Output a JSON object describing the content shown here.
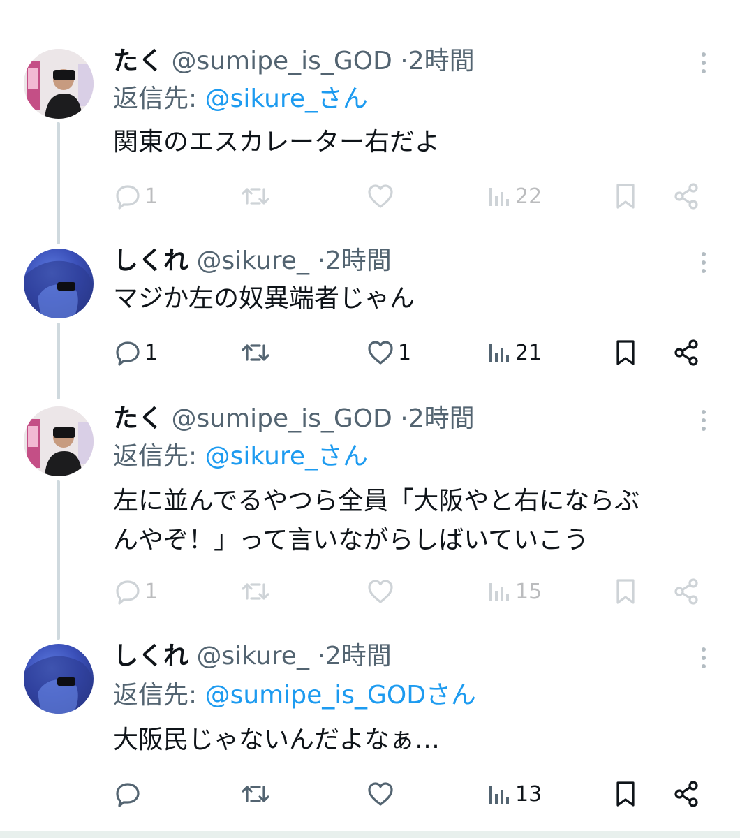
{
  "tweets": [
    {
      "name": "たく",
      "handle": "@sumipe_is_GOD",
      "separator": "·",
      "time": "2時間",
      "reply_prefix": "返信先: ",
      "reply_to": "@sikure_さん",
      "text": "関東のエスカレーター右だよ",
      "replies": "1",
      "retweets": "",
      "likes": "",
      "views": "22"
    },
    {
      "name": "しくれ",
      "handle": "@sikure_",
      "separator": "·",
      "time": "2時間",
      "text": "マジか左の奴異端者じゃん",
      "replies": "1",
      "retweets": "",
      "likes": "1",
      "views": "21"
    },
    {
      "name": "たく",
      "handle": "@sumipe_is_GOD",
      "separator": "·",
      "time": "2時間",
      "reply_prefix": "返信先: ",
      "reply_to": "@sikure_さん",
      "text_line1": "左に並んでるやつら全員「大阪やと右にならぶ",
      "text_line2": "んやぞ！」って言いながらしばいていこう",
      "replies": "1",
      "retweets": "",
      "likes": "",
      "views": "15"
    },
    {
      "name": "しくれ",
      "handle": "@sikure_",
      "separator": "·",
      "time": "2時間",
      "reply_prefix": "返信先: ",
      "reply_to": "@sumipe_is_GODさん",
      "text": "大阪民じゃないんだよなぁ…",
      "replies": "",
      "retweets": "",
      "likes": "",
      "views": "13"
    }
  ],
  "icons": [
    "reply-icon",
    "retweet-icon",
    "like-icon",
    "views-icon",
    "bookmark-icon",
    "share-icon",
    "more-icon"
  ],
  "colors": {
    "text": "#0f1419",
    "secondary": "#536471",
    "link": "#1d9bf0",
    "thread_line": "#cfd9de"
  }
}
